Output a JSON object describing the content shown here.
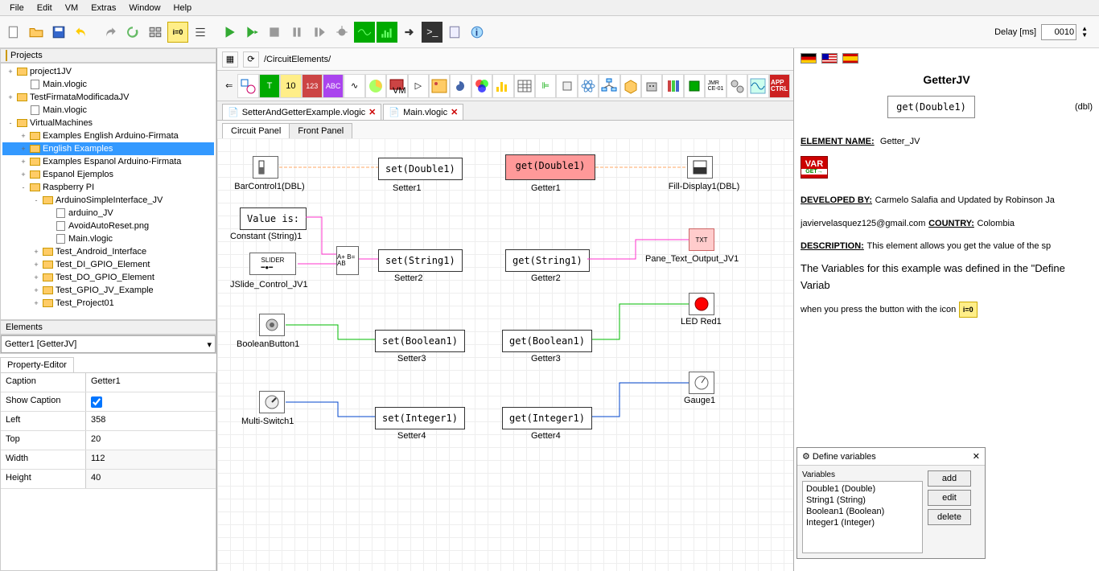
{
  "menu": {
    "items": [
      "File",
      "Edit",
      "VM",
      "Extras",
      "Window",
      "Help"
    ]
  },
  "delay": {
    "label": "Delay [ms]",
    "value": "0010"
  },
  "projects": {
    "title": "Projects",
    "tree": [
      {
        "d": 0,
        "t": "+",
        "ico": "folder",
        "txt": "project1JV"
      },
      {
        "d": 1,
        "t": "",
        "ico": "file",
        "txt": "Main.vlogic"
      },
      {
        "d": 0,
        "t": "+",
        "ico": "folder",
        "txt": "TestFirmataModificadaJV"
      },
      {
        "d": 1,
        "t": "",
        "ico": "file",
        "txt": "Main.vlogic"
      },
      {
        "d": 0,
        "t": "-",
        "ico": "folder",
        "txt": "VirtualMachines"
      },
      {
        "d": 1,
        "t": "+",
        "ico": "folder",
        "txt": "Examples English Arduino-Firmata"
      },
      {
        "d": 1,
        "t": "+",
        "ico": "folder",
        "txt": "English Examples",
        "sel": true
      },
      {
        "d": 1,
        "t": "+",
        "ico": "folder",
        "txt": "Examples Espanol Arduino-Firmata"
      },
      {
        "d": 1,
        "t": "+",
        "ico": "folder",
        "txt": "Espanol Ejemplos"
      },
      {
        "d": 1,
        "t": "-",
        "ico": "folder",
        "txt": "Raspberry PI"
      },
      {
        "d": 2,
        "t": "-",
        "ico": "folder",
        "txt": "ArduinoSimpleInterface_JV"
      },
      {
        "d": 3,
        "t": "",
        "ico": "file",
        "txt": "arduino_JV"
      },
      {
        "d": 3,
        "t": "",
        "ico": "file",
        "txt": "AvoidAutoReset.png"
      },
      {
        "d": 3,
        "t": "",
        "ico": "file",
        "txt": "Main.vlogic"
      },
      {
        "d": 2,
        "t": "+",
        "ico": "folder",
        "txt": "Test_Android_Interface"
      },
      {
        "d": 2,
        "t": "+",
        "ico": "folder",
        "txt": "Test_DI_GPIO_Element"
      },
      {
        "d": 2,
        "t": "+",
        "ico": "folder",
        "txt": "Test_DO_GPIO_Element"
      },
      {
        "d": 2,
        "t": "+",
        "ico": "folder",
        "txt": "Test_GPIO_JV_Example"
      },
      {
        "d": 2,
        "t": "+",
        "ico": "folder",
        "txt": "Test_Project01"
      }
    ]
  },
  "elements": {
    "title": "Elements",
    "selected": "Getter1 [GetterJV]"
  },
  "prop": {
    "tab": "Property-Editor",
    "rows": [
      {
        "k": "Caption",
        "v": "Getter1",
        "w": true
      },
      {
        "k": "Show Caption",
        "v": "checkbox",
        "w": true
      },
      {
        "k": "Left",
        "v": "358",
        "w": true
      },
      {
        "k": "Top",
        "v": "20",
        "w": true
      },
      {
        "k": "Width",
        "v": "112"
      },
      {
        "k": "Height",
        "v": "40"
      }
    ]
  },
  "breadcrumb": "/CircuitElements/",
  "fileTabs": [
    {
      "name": "SetterAndGetterExample.vlogic",
      "close": true
    },
    {
      "name": "Main.vlogic",
      "close": true
    }
  ],
  "panelTabs": [
    "Circuit Panel",
    "Front Panel"
  ],
  "canvas": {
    "blocks": {
      "bar": {
        "label": "BarControl1(DBL)"
      },
      "set1": {
        "txt": "set(Double1)",
        "label": "Setter1"
      },
      "get1": {
        "txt": "get(Double1)",
        "label": "Getter1"
      },
      "fill": {
        "label": "Fill-Display1(DBL)"
      },
      "const": {
        "txt": "Value is:",
        "label": "Constant (String)1"
      },
      "slider": {
        "label": "JSlide_Control_JV1"
      },
      "concat": {
        "txt": "A+\nB=\nAB"
      },
      "set2": {
        "txt": "set(String1)",
        "label": "Setter2"
      },
      "get2": {
        "txt": "get(String1)",
        "label": "Getter2"
      },
      "pane": {
        "label": "Pane_Text_Output_JV1"
      },
      "boolbtn": {
        "label": "BooleanButton1"
      },
      "set3": {
        "txt": "set(Boolean1)",
        "label": "Setter3"
      },
      "get3": {
        "txt": "get(Boolean1)",
        "label": "Getter3"
      },
      "led": {
        "label": "LED Red1"
      },
      "multi": {
        "label": "Multi-Switch1"
      },
      "set4": {
        "txt": "set(Integer1)",
        "label": "Setter4"
      },
      "get4": {
        "txt": "get(Integer1)",
        "label": "Getter4"
      },
      "gauge": {
        "label": "Gauge1"
      }
    }
  },
  "doc": {
    "title": "GetterJV",
    "box": "get(Double1)",
    "dbl": "(dbl)",
    "elname_k": "ELEMENT NAME:",
    "elname_v": "Getter_JV",
    "dev_k": "DEVELOPED BY:",
    "dev_v": "Carmelo Salafia and Updated by Robinson Ja",
    "email": "javiervelasquez125@gmail.com",
    "country_k": "COUNTRY:",
    "country_v": "Colombia",
    "desc_k": "DESCRIPTION:",
    "desc_v": "This element allows you get the value of the sp",
    "line1": "The Variables for this example was defined in the \"Define Variab",
    "line2": "when you press the button with the icon"
  },
  "dialog": {
    "title": "Define variables",
    "hdr": "Variables",
    "items": [
      "Double1 (Double)",
      "String1 (String)",
      "Boolean1 (Boolean)",
      "Integer1 (Integer)"
    ],
    "btns": {
      "add": "add",
      "edit": "edit",
      "del": "delete"
    }
  }
}
